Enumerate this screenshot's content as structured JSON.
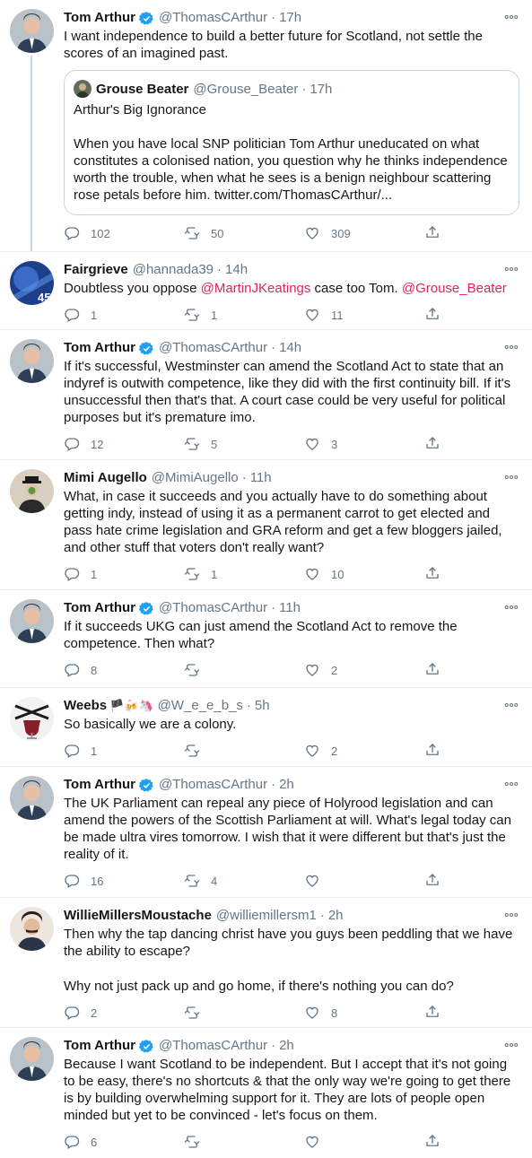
{
  "tweets": [
    {
      "name": "Tom Arthur",
      "handle": "@ThomasCArthur",
      "time": "17h",
      "verified": true,
      "text": "I want independence to build a better future for Scotland, not settle the scores of an imagined past.",
      "quote": {
        "name": "Grouse Beater",
        "handle": "@Grouse_Beater",
        "time": "17h",
        "title": "Arthur's Big Ignorance",
        "body": "When you have local SNP politician Tom Arthur uneducated on what constitutes a colonised nation, you question why he thinks independence worth the trouble, when what he sees is a benign neighbour scattering rose petals before him. twitter.com/ThomasCArthur/..."
      },
      "replies": "102",
      "retweets": "50",
      "likes": "309"
    },
    {
      "name": "Fairgrieve",
      "handle": "@hannada39",
      "time": "14h",
      "verified": false,
      "text_before": "Doubtless you oppose ",
      "mention1": "@MartinJKeatings",
      "text_middle": " case too Tom. ",
      "mention2": "@Grouse_Beater",
      "replies": "1",
      "retweets": "1",
      "likes": "11"
    },
    {
      "name": "Tom Arthur",
      "handle": "@ThomasCArthur",
      "time": "14h",
      "verified": true,
      "text": "If it's successful, Westminster can amend the Scotland Act to state that an indyref is outwith competence, like they did with the first continuity bill. If it's unsuccessful then that's that. A court case could be very useful for political purposes but it's premature imo.",
      "replies": "12",
      "retweets": "5",
      "likes": "3"
    },
    {
      "name": "Mimi Augello",
      "handle": "@MimiAugello",
      "time": "11h",
      "verified": false,
      "text": "What, in case it succeeds and you actually have to do something about getting indy, instead of using it as a permanent carrot to get elected and pass hate crime legislation and GRA reform and get a few bloggers jailed, and other stuff that voters don't really want?",
      "replies": "1",
      "retweets": "1",
      "likes": "10"
    },
    {
      "name": "Tom Arthur",
      "handle": "@ThomasCArthur",
      "time": "11h",
      "verified": true,
      "text": "If it succeeds UKG can just amend the Scotland Act to remove the competence. Then what?",
      "replies": "8",
      "retweets": "",
      "likes": "2"
    },
    {
      "name": "Weebs",
      "name_emoji": "🏴🍻🦄",
      "handle": "@W_e_e_b_s",
      "time": "5h",
      "verified": false,
      "text": "So basically we are a colony.",
      "replies": "1",
      "retweets": "",
      "likes": "2"
    },
    {
      "name": "Tom Arthur",
      "handle": "@ThomasCArthur",
      "time": "2h",
      "verified": true,
      "text": "The UK Parliament can repeal any piece of Holyrood legislation and can amend the powers of the Scottish Parliament at will. What's legal today can be made ultra vires tomorrow. I wish that it were different but that's just the reality of it.",
      "replies": "16",
      "retweets": "4",
      "likes": ""
    },
    {
      "name": "WillieMillersMoustache",
      "handle": "@williemillersm1",
      "time": "2h",
      "verified": false,
      "text": "Then why the tap dancing christ have you guys been peddling that we have the ability to escape?",
      "text2": "Why not just pack up and go home, if there's nothing you can do?",
      "replies": "2",
      "retweets": "",
      "likes": "8"
    },
    {
      "name": "Tom Arthur",
      "handle": "@ThomasCArthur",
      "time": "2h",
      "verified": true,
      "text": "Because I want Scotland to be independent. But I accept that it's not going to be easy, there's no shortcuts & that the only way we're going to get there is by building overwhelming support for it. They are lots of people open minded but yet to be convinced - let's focus on them.",
      "replies": "6",
      "retweets": "",
      "likes": ""
    }
  ],
  "dot": "·",
  "colors": {
    "text": "#14171a",
    "secondary": "#657786",
    "mention": "#e0245e",
    "verified": "#1da1f2",
    "border": "#e6ecf0"
  }
}
